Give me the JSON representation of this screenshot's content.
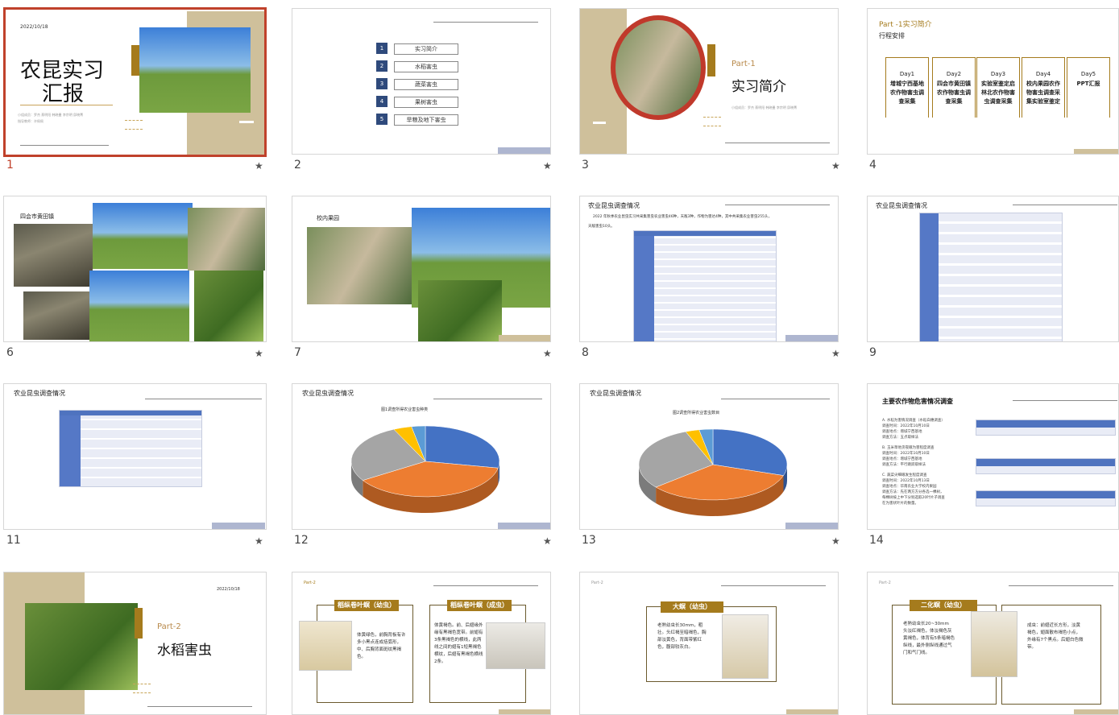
{
  "slides": [
    {
      "num": "1",
      "date": "2022/10/18",
      "title1": "农昆实习",
      "title2": "汇报",
      "sub1": "小组成员：罗杰 蔡明阳 韩晓曼 李宗明 邱晓菁",
      "sub2": "指导教师：许佩佩"
    },
    {
      "num": "2",
      "menu": [
        {
          "idx": "1",
          "label": "实习简介"
        },
        {
          "idx": "2",
          "label": "水稻害虫"
        },
        {
          "idx": "3",
          "label": "蔬菜害虫"
        },
        {
          "idx": "4",
          "label": "果树害虫"
        },
        {
          "idx": "5",
          "label": "旱粮及地下害虫"
        }
      ]
    },
    {
      "num": "3",
      "part": "Part-1",
      "title": "实习简介",
      "sub": "小组成员：罗杰 蔡明阳 韩晓曼 李宗明 邱晓菁"
    },
    {
      "num": "4",
      "part": "Part -1实习简介",
      "subtitle": "行程安排",
      "days": [
        {
          "day": "Day1",
          "text": "增城宁西基地农作物害虫调查采集"
        },
        {
          "day": "Day2",
          "text": "四会市黄田镇农作物害虫调查采集"
        },
        {
          "day": "Day3",
          "text": "实验室鉴定启林北农作物害虫调查采集"
        },
        {
          "day": "Day4",
          "text": "校内果园农作物害虫调查采集实验室鉴定"
        },
        {
          "day": "Day5",
          "text": "PPT汇报"
        }
      ]
    },
    {
      "num": "6",
      "title": "四会市黄田镇"
    },
    {
      "num": "7",
      "title": "校内果园"
    },
    {
      "num": "8",
      "title": "农业昆虫调查情况",
      "text1": "2022 年秋季农业昆虫实习共采集害虫农业害虫46种，天敌3种，作物为害达4种，其中共采集农业害虫255头，",
      "text2": "天敌害虫10头。"
    },
    {
      "num": "9",
      "title": "农业昆虫调查情况"
    },
    {
      "num": "11",
      "title": "农业昆虫调查情况"
    },
    {
      "num": "12",
      "title": "农业昆虫调查情况",
      "chart_title": "图1调查所得农业害虫种类"
    },
    {
      "num": "13",
      "title": "农业昆虫调查情况",
      "chart_title": "图2调查所得农业害虫数目"
    },
    {
      "num": "14",
      "title": "主要农作物危害情况调查",
      "p1": [
        "A. 水稻为害情况调查（水稻白穗调查）",
        "调查时间：2022年10月10日",
        "调查地点：增城宁西基地",
        "调查方法：五点取样法"
      ],
      "p2": [
        "B. 玉米草地贪夜蛾为害程度调查",
        "调查时间：2022年10月10日",
        "调查地点：增城宁西基地",
        "调查方法：平行跳跃取样法"
      ],
      "p3": [
        "C. 蔬菜尖细蛾发生程度调查",
        "调查时间：2022年10月13日",
        "调查地点：华南农业大学校内果园",
        "调查方法：先在两方方分各选一棵树，",
        "每棵树按上中下分别选取20叶片子调查",
        "在为害状叶片的数量。"
      ]
    },
    {
      "num": "",
      "date": "2022/10/18",
      "part": "Part-2",
      "title": "水稻害虫"
    },
    {
      "num": "",
      "part": "Part-2",
      "tag1": "稻纵卷叶螟（幼虫）",
      "tag2": "稻纵卷叶螟（成虫）",
      "text1": "体黄绿色，前胸背板有许多小黑点连成括弧形，中、后胸背面斑纹黑褐色。",
      "text2": "体黄褐色。前、后翅缘外缘有黑褐色宽带。前翅有3条黑褐色的横线，此两线之间的翅有1短黑褐色横纹，后翅有黑褐色横线2条。"
    },
    {
      "num": "",
      "part": "Part-2",
      "tag": "大螟（幼虫）",
      "text": "老熟幼虫长30mm，粗壮。头红褐至暗褐色，胸部淡黄色，背面带紫红色，腹部较灰白。"
    },
    {
      "num": "",
      "part": "Part-2",
      "tag": "二化螟（幼虫）",
      "text1": "老熟幼虫长20~30mm 头淡红褐色，体淡褐色灰黄褐色，体背有5条暗褐色纵线，最外侧纵线通过气门和气门线。",
      "text2": "成虫：前翅近长方形，淡黄褐色，翅面散布褐色小点，外缘有7个黑点。后翅白色微带。"
    }
  ],
  "star": "★",
  "chart_data": [
    {
      "type": "pie",
      "title": "图1调查所得农业害虫种类",
      "series": [
        {
          "name": "",
          "values": [
            28,
            38,
            27,
            4,
            3
          ]
        }
      ]
    },
    {
      "type": "pie",
      "title": "图2调查所得农业害虫数目",
      "series": [
        {
          "name": "",
          "values": [
            30,
            34,
            30,
            3,
            3
          ]
        }
      ]
    }
  ],
  "colors": {
    "accent": "#a57b1d",
    "beige": "#cfc09b",
    "selection": "#c0412b",
    "table_blue": "#4f73bf"
  }
}
